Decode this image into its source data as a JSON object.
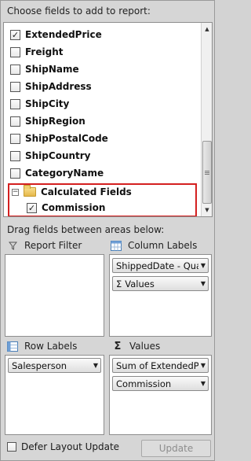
{
  "header": {
    "title": "Choose fields to add to report:"
  },
  "fields": [
    {
      "label": "ExtendedPrice",
      "checked": true
    },
    {
      "label": "Freight",
      "checked": false
    },
    {
      "label": "ShipName",
      "checked": false
    },
    {
      "label": "ShipAddress",
      "checked": false
    },
    {
      "label": "ShipCity",
      "checked": false
    },
    {
      "label": "ShipRegion",
      "checked": false
    },
    {
      "label": "ShipPostalCode",
      "checked": false
    },
    {
      "label": "ShipCountry",
      "checked": false
    },
    {
      "label": "CategoryName",
      "checked": false
    }
  ],
  "calculated": {
    "folder_label": "Calculated Fields",
    "expander_glyph": "−",
    "items": [
      {
        "label": "Commission",
        "checked": true
      }
    ]
  },
  "drag_instruction": "Drag fields between areas below:",
  "zones": {
    "report_filter": {
      "label": "Report Filter",
      "icon": "filter-icon",
      "items": []
    },
    "column_labels": {
      "label": "Column Labels",
      "icon": "column-labels-icon",
      "items": [
        {
          "label": "ShippedDate - Qua"
        },
        {
          "label": "Values",
          "prefix": "Σ"
        }
      ]
    },
    "row_labels": {
      "label": "Row Labels",
      "icon": "row-labels-icon",
      "items": [
        {
          "label": "Salesperson"
        }
      ]
    },
    "values": {
      "label": "Values",
      "icon": "sigma-icon",
      "icon_glyph": "Σ",
      "items": [
        {
          "label": "Sum of ExtendedPr"
        },
        {
          "label": "Commission"
        }
      ]
    }
  },
  "footer": {
    "defer_label": "Defer Layout Update",
    "defer_checked": false,
    "update_label": "Update",
    "update_enabled": false
  },
  "glyphs": {
    "check": "✓",
    "dropdown": "▼",
    "scroll_up": "▲",
    "scroll_down": "▼"
  },
  "colors": {
    "highlight_border": "#d42020",
    "panel_bg": "#d6d6d6"
  }
}
